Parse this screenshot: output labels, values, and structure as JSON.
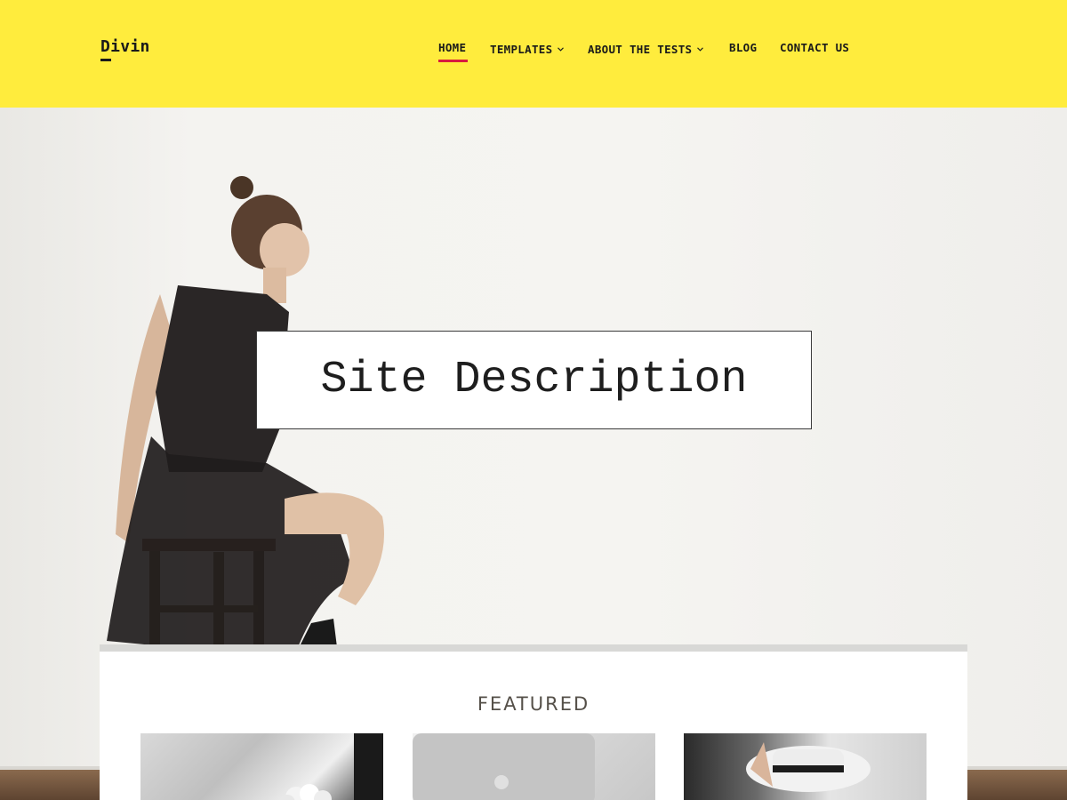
{
  "site": {
    "logo": "Divin"
  },
  "nav": {
    "items": [
      {
        "label": "HOME",
        "active": true,
        "has_dropdown": false
      },
      {
        "label": "TEMPLATES",
        "active": false,
        "has_dropdown": true
      },
      {
        "label": "ABOUT THE TESTS",
        "active": false,
        "has_dropdown": true
      },
      {
        "label": "BLOG",
        "active": false,
        "has_dropdown": false
      },
      {
        "label": "CONTACT US",
        "active": false,
        "has_dropdown": false
      }
    ]
  },
  "hero": {
    "description": "Site Description"
  },
  "featured": {
    "title": "FEATURED",
    "thumbnails": [
      "photo-flowers",
      "photo-laptop",
      "photo-woman-hat"
    ]
  },
  "colors": {
    "header_bg": "#ffec3d",
    "active_accent": "#d81b3f",
    "text_dark": "#1a1a1a"
  },
  "icons": {
    "dropdown": "chevron-down-icon"
  }
}
